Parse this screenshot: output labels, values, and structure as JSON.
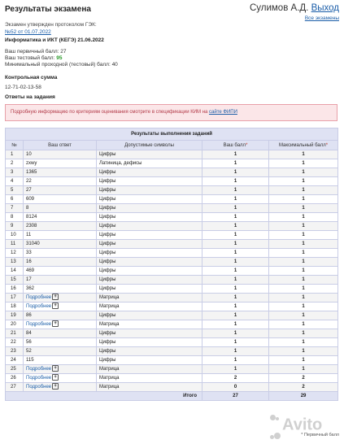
{
  "header": {
    "title": "Результаты экзамена",
    "user_name": "Сулимов А.Д.",
    "logout": "Выход",
    "all_exams": "Все экзамены"
  },
  "protocol": {
    "line1": "Экзамен утвержден протоколом ГЭК:",
    "link": "№52 от 01.07.2022"
  },
  "subject": "Информатика и ИКТ (КЕГЭ) 21.06.2022",
  "scores": {
    "primary_label": "Ваш первичный балл:",
    "primary_value": "27",
    "test_label": "Ваш тестовый балл:",
    "test_value": "95",
    "min_label": "Минимальный проходной (тестовый) балл:",
    "min_value": "40"
  },
  "checksum": {
    "title": "Контрольная сумма",
    "value": "12-71-02-13-58"
  },
  "answers_title": "Ответы на задания",
  "alert": {
    "text": "Подробную информацию по критериям оценивания смотрите в спецификации КИМ на",
    "link": "сайте ФИПИ"
  },
  "table": {
    "caption": "Результаты выполнения заданий",
    "columns": [
      "№",
      "Ваш ответ",
      "Допустимые символы",
      "Ваш балл",
      "Максимальный балл"
    ],
    "more_label": "Подробнее",
    "rows": [
      {
        "n": "1",
        "answer": "10",
        "allowed": "Цифры",
        "score": "1",
        "max": "1"
      },
      {
        "n": "2",
        "answer": "zxwy",
        "allowed": "Латиница, дефисы",
        "score": "1",
        "max": "1"
      },
      {
        "n": "3",
        "answer": "1365",
        "allowed": "Цифры",
        "score": "1",
        "max": "1"
      },
      {
        "n": "4",
        "answer": "22",
        "allowed": "Цифры",
        "score": "1",
        "max": "1"
      },
      {
        "n": "5",
        "answer": "27",
        "allowed": "Цифры",
        "score": "1",
        "max": "1"
      },
      {
        "n": "6",
        "answer": "609",
        "allowed": "Цифры",
        "score": "1",
        "max": "1"
      },
      {
        "n": "7",
        "answer": "8",
        "allowed": "Цифры",
        "score": "1",
        "max": "1"
      },
      {
        "n": "8",
        "answer": "8124",
        "allowed": "Цифры",
        "score": "1",
        "max": "1"
      },
      {
        "n": "9",
        "answer": "2308",
        "allowed": "Цифры",
        "score": "1",
        "max": "1"
      },
      {
        "n": "10",
        "answer": "11",
        "allowed": "Цифры",
        "score": "1",
        "max": "1"
      },
      {
        "n": "11",
        "answer": "31040",
        "allowed": "Цифры",
        "score": "1",
        "max": "1"
      },
      {
        "n": "12",
        "answer": "33",
        "allowed": "Цифры",
        "score": "1",
        "max": "1"
      },
      {
        "n": "13",
        "answer": "16",
        "allowed": "Цифры",
        "score": "1",
        "max": "1"
      },
      {
        "n": "14",
        "answer": "469",
        "allowed": "Цифры",
        "score": "1",
        "max": "1"
      },
      {
        "n": "15",
        "answer": "17",
        "allowed": "Цифры",
        "score": "1",
        "max": "1"
      },
      {
        "n": "16",
        "answer": "362",
        "allowed": "Цифры",
        "score": "1",
        "max": "1"
      },
      {
        "n": "17",
        "answer": "",
        "more": true,
        "allowed": "Матрица",
        "score": "1",
        "max": "1"
      },
      {
        "n": "18",
        "answer": "",
        "more": true,
        "allowed": "Матрица",
        "score": "1",
        "max": "1"
      },
      {
        "n": "19",
        "answer": "86",
        "allowed": "Цифры",
        "score": "1",
        "max": "1"
      },
      {
        "n": "20",
        "answer": "",
        "more": true,
        "allowed": "Матрица",
        "score": "1",
        "max": "1"
      },
      {
        "n": "21",
        "answer": "84",
        "allowed": "Цифры",
        "score": "1",
        "max": "1"
      },
      {
        "n": "22",
        "answer": "56",
        "allowed": "Цифры",
        "score": "1",
        "max": "1"
      },
      {
        "n": "23",
        "answer": "52",
        "allowed": "Цифры",
        "score": "1",
        "max": "1"
      },
      {
        "n": "24",
        "answer": "115",
        "allowed": "Цифры",
        "score": "1",
        "max": "1"
      },
      {
        "n": "25",
        "answer": "",
        "more": true,
        "allowed": "Матрица",
        "score": "1",
        "max": "1"
      },
      {
        "n": "26",
        "answer": "",
        "more": true,
        "allowed": "Матрица",
        "score": "2",
        "max": "2"
      },
      {
        "n": "27",
        "answer": "",
        "more": true,
        "allowed": "Матрица",
        "score": "0",
        "max": "2"
      }
    ],
    "total_label": "Итого",
    "total_score": "27",
    "total_max": "29"
  },
  "footnote": "* Первичный балл",
  "watermark": "Avito",
  "icons": {
    "more": "plus-box-icon",
    "watermark": "avito-logo-icon"
  },
  "colors": {
    "link": "#1a5da8",
    "alert_bg": "#fbe6e8",
    "alert_text": "#b23a48",
    "table_header": "#dfe2f3",
    "green_score": "#2a9a2a"
  }
}
